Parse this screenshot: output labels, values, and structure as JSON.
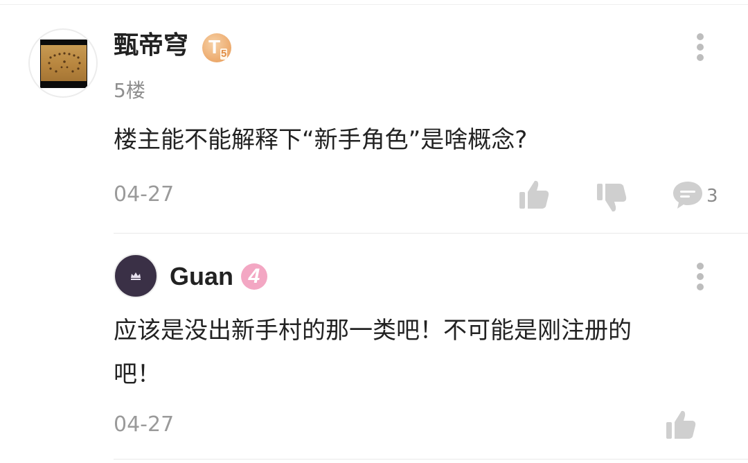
{
  "comment": {
    "username": "甄帝穹",
    "badge_letter": "T",
    "badge_level": "5",
    "floor": "5楼",
    "text": "楼主能不能解释下“新手角色”是啥概念?",
    "date": "04-27",
    "reply_count": "3"
  },
  "reply": {
    "username": "Guan",
    "level": "4",
    "text_line1": "应该是没出新手村的那一类吧！不可能是刚注册的",
    "text_line2": "吧！",
    "date": "04-27"
  },
  "colors": {
    "icon_gray": "#cfcfcf",
    "badge_orange": "#eeaf74",
    "badge_pink": "#f3a7c3"
  }
}
